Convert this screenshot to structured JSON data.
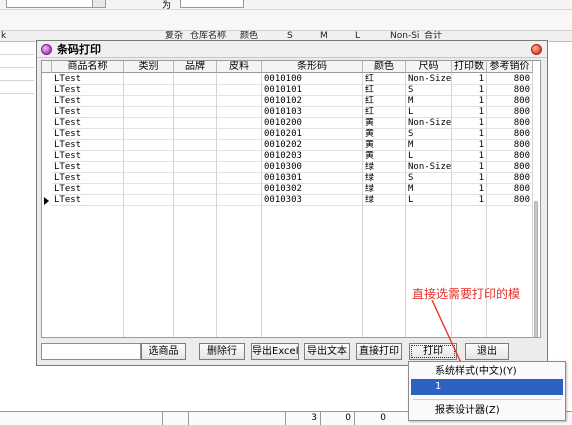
{
  "background": {
    "toolbar_label": "为",
    "left_fragment": "k",
    "header_columns": [
      "复杂",
      "仓库名称",
      "颜色",
      "S",
      "M",
      "L",
      "Non-Si",
      "合计"
    ],
    "footer_values": [
      "3",
      "0",
      "0"
    ]
  },
  "dialog": {
    "title": "条码打印",
    "grid": {
      "columns": [
        "商品名称",
        "类别",
        "品牌",
        "皮料",
        "条形码",
        "颜色",
        "尺码",
        "打印数",
        "参考销价"
      ],
      "rows": [
        {
          "name": "LTest",
          "category": "",
          "brand": "",
          "leather": "",
          "barcode": "0010100",
          "color": "红",
          "size": "Non-Size",
          "qty": "1",
          "price": "800"
        },
        {
          "name": "LTest",
          "category": "",
          "brand": "",
          "leather": "",
          "barcode": "0010101",
          "color": "红",
          "size": "S",
          "qty": "1",
          "price": "800"
        },
        {
          "name": "LTest",
          "category": "",
          "brand": "",
          "leather": "",
          "barcode": "0010102",
          "color": "红",
          "size": "M",
          "qty": "1",
          "price": "800"
        },
        {
          "name": "LTest",
          "category": "",
          "brand": "",
          "leather": "",
          "barcode": "0010103",
          "color": "红",
          "size": "L",
          "qty": "1",
          "price": "800"
        },
        {
          "name": "LTest",
          "category": "",
          "brand": "",
          "leather": "",
          "barcode": "0010200",
          "color": "黄",
          "size": "Non-Size",
          "qty": "1",
          "price": "800"
        },
        {
          "name": "LTest",
          "category": "",
          "brand": "",
          "leather": "",
          "barcode": "0010201",
          "color": "黄",
          "size": "S",
          "qty": "1",
          "price": "800"
        },
        {
          "name": "LTest",
          "category": "",
          "brand": "",
          "leather": "",
          "barcode": "0010202",
          "color": "黄",
          "size": "M",
          "qty": "1",
          "price": "800"
        },
        {
          "name": "LTest",
          "category": "",
          "brand": "",
          "leather": "",
          "barcode": "0010203",
          "color": "黄",
          "size": "L",
          "qty": "1",
          "price": "800"
        },
        {
          "name": "LTest",
          "category": "",
          "brand": "",
          "leather": "",
          "barcode": "0010300",
          "color": "绿",
          "size": "Non-Size",
          "qty": "1",
          "price": "800"
        },
        {
          "name": "LTest",
          "category": "",
          "brand": "",
          "leather": "",
          "barcode": "0010301",
          "color": "绿",
          "size": "S",
          "qty": "1",
          "price": "800"
        },
        {
          "name": "LTest",
          "category": "",
          "brand": "",
          "leather": "",
          "barcode": "0010302",
          "color": "绿",
          "size": "M",
          "qty": "1",
          "price": "800"
        },
        {
          "name": "LTest",
          "category": "",
          "brand": "",
          "leather": "",
          "barcode": "0010303",
          "color": "绿",
          "size": "L",
          "qty": "1",
          "price": "800"
        }
      ],
      "current_row": 11
    },
    "search_value": "",
    "buttons": {
      "select_product": "选商品",
      "delete_row": "删除行",
      "export_excel": "导出Excel",
      "export_text": "导出文本",
      "direct_print": "直接打印",
      "print": "打印",
      "exit": "退出"
    }
  },
  "annotation": {
    "text": "直接选需要打印的模",
    "color": "#e8312a"
  },
  "print_menu": {
    "items": [
      "系统样式(中文)(Y)",
      "1",
      "报表设计器(Z)"
    ],
    "selected_index": 1
  },
  "colors": {
    "menu_highlight": "#2c62c4",
    "dialog_icon": "#b23ac0",
    "close_icon": "#e0401e"
  }
}
